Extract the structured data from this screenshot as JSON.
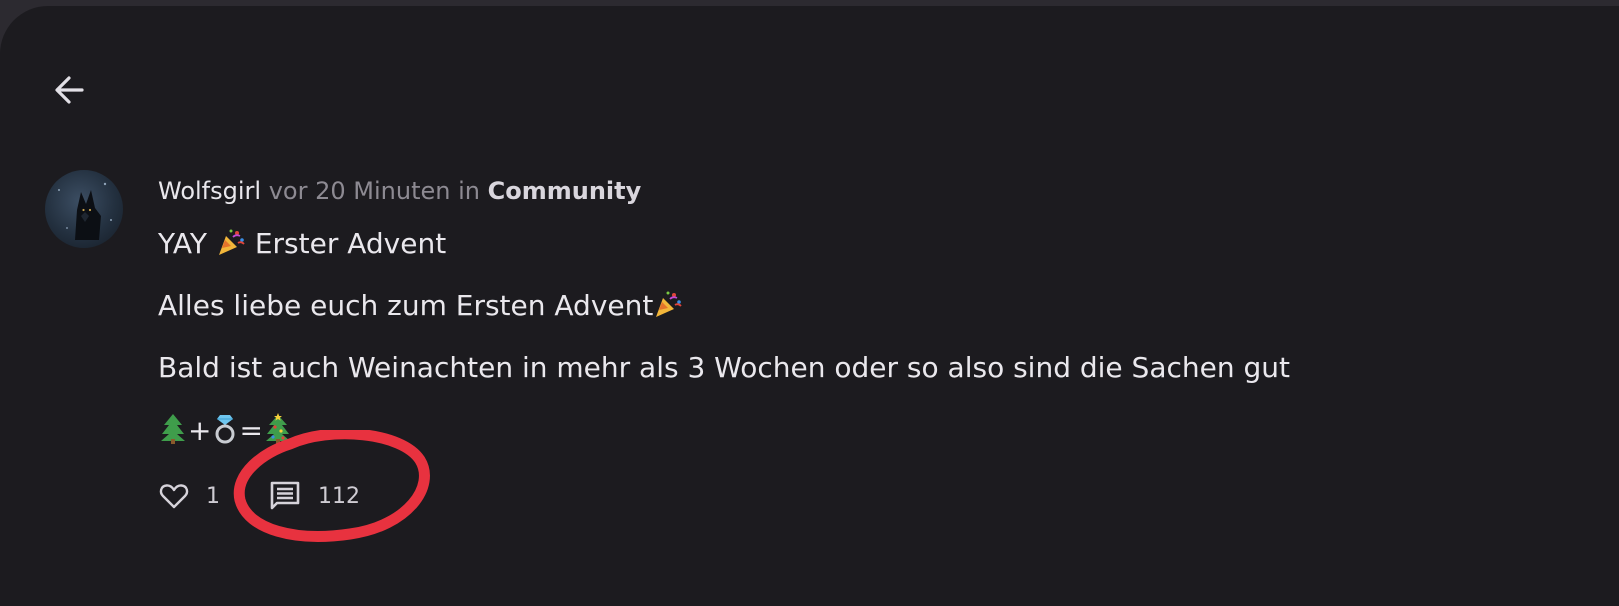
{
  "nav": {
    "back_icon": "arrow-left-icon"
  },
  "post": {
    "avatar_icon": "wolf-avatar",
    "author": "Wolfsgirl",
    "time": "vor 20 Minuten",
    "in_text": "in",
    "community": "Community",
    "lines": [
      {
        "text": "YAY ",
        "emoji": "party-popper",
        "text_after": " Erster Advent"
      },
      {
        "text": "Alles liebe euch zum Ersten Advent",
        "emoji": "party-popper"
      },
      {
        "text": "Bald ist auch Weinachten in mehr als 3 Wochen oder so also sind die Sachen gut"
      },
      {
        "emojis": [
          "evergreen-tree",
          "ring",
          "christmas-tree"
        ],
        "plus": "+",
        "equals": "="
      }
    ],
    "likes": "1",
    "comments": "112"
  },
  "colors": {
    "background": "#1c1b1f",
    "text": "#eae8ed",
    "muted": "#8d8a92",
    "annotation": "#e8323f"
  }
}
